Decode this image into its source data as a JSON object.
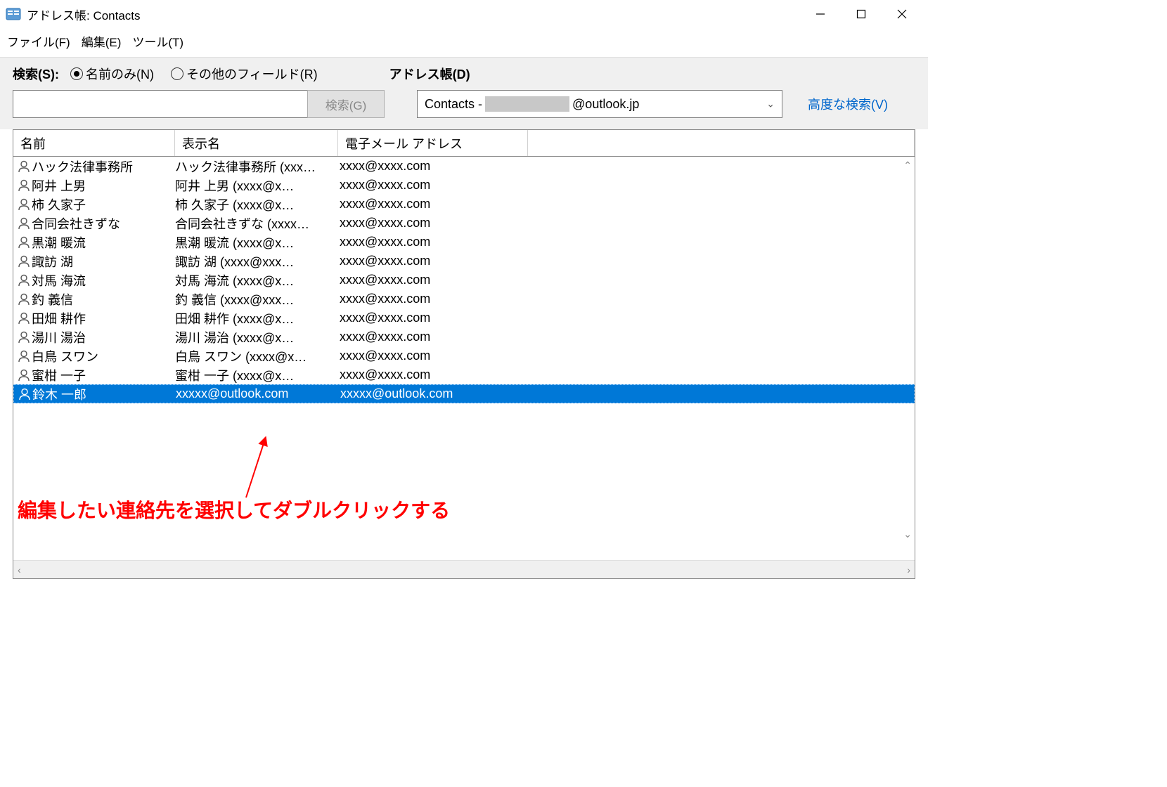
{
  "window": {
    "title": "アドレス帳: Contacts"
  },
  "menu": {
    "file": "ファイル(F)",
    "edit": "編集(E)",
    "tools": "ツール(T)"
  },
  "search": {
    "label": "検索(S):",
    "radio_name": "名前のみ(N)",
    "radio_other": "その他のフィールド(R)",
    "button": "検索(G)",
    "input_value": ""
  },
  "addressbook": {
    "label": "アドレス帳(D)",
    "select_prefix": "Contacts - ",
    "select_suffix": "@outlook.jp",
    "advanced": "高度な検索(V)"
  },
  "columns": {
    "name": "名前",
    "display": "表示名",
    "email": "電子メール アドレス"
  },
  "contacts": [
    {
      "name": "ハック法律事務所",
      "display": "ハック法律事務所 (xxx…",
      "email": "xxxx@xxxx.com",
      "selected": false
    },
    {
      "name": "阿井  上男",
      "display": "阿井  上男 (xxxx@x…",
      "email": "xxxx@xxxx.com",
      "selected": false
    },
    {
      "name": "柿  久家子",
      "display": "柿  久家子 (xxxx@x…",
      "email": "xxxx@xxxx.com",
      "selected": false
    },
    {
      "name": "合同会社きずな",
      "display": "合同会社きずな (xxxx…",
      "email": "xxxx@xxxx.com",
      "selected": false
    },
    {
      "name": "黒潮  暖流",
      "display": "黒潮  暖流 (xxxx@x…",
      "email": "xxxx@xxxx.com",
      "selected": false
    },
    {
      "name": "諏訪  湖",
      "display": "諏訪  湖 (xxxx@xxx…",
      "email": "xxxx@xxxx.com",
      "selected": false
    },
    {
      "name": "対馬  海流",
      "display": "対馬  海流 (xxxx@x…",
      "email": "xxxx@xxxx.com",
      "selected": false
    },
    {
      "name": "釣  義信",
      "display": "釣  義信 (xxxx@xxx…",
      "email": "xxxx@xxxx.com",
      "selected": false
    },
    {
      "name": "田畑  耕作",
      "display": "田畑  耕作 (xxxx@x…",
      "email": "xxxx@xxxx.com",
      "selected": false
    },
    {
      "name": "湯川  湯治",
      "display": "湯川  湯治 (xxxx@x…",
      "email": "xxxx@xxxx.com",
      "selected": false
    },
    {
      "name": "白鳥  スワン",
      "display": "白鳥  スワン (xxxx@x…",
      "email": "xxxx@xxxx.com",
      "selected": false
    },
    {
      "name": "蜜柑  一子",
      "display": "蜜柑  一子 (xxxx@x…",
      "email": "xxxx@xxxx.com",
      "selected": false
    },
    {
      "name": "鈴木 一郎",
      "display": "xxxxx@outlook.com",
      "email": "xxxxx@outlook.com",
      "selected": true
    }
  ],
  "annotation": {
    "text": "編集したい連絡先を選択してダブルクリックする"
  }
}
